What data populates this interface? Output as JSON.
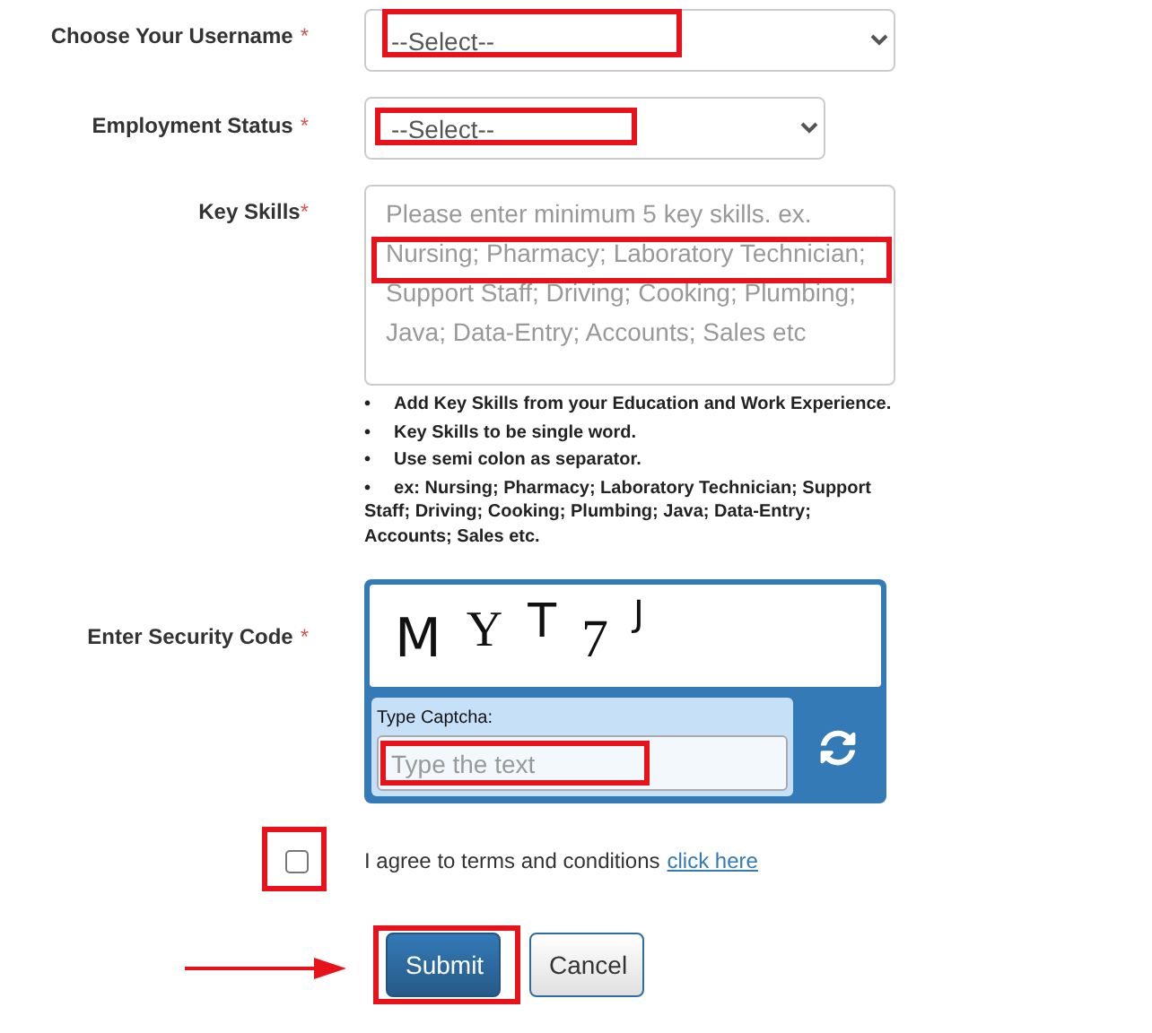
{
  "username": {
    "label": "Choose Your Username",
    "required_mark": "*",
    "value": "--Select--",
    "highlighted": true
  },
  "employment": {
    "label": "Employment Status",
    "required_mark": "*",
    "value": "--Select--",
    "highlighted": true
  },
  "key_skills": {
    "label": "Key Skills",
    "required_mark": "*",
    "placeholder": "Please enter minimum 5 key skills. ex. Nursing; Pharmacy; Laboratory Technician; Support Staff; Driving; Cooking; Plumbing; Java; Data-Entry; Accounts; Sales etc",
    "highlighted": true,
    "hints": [
      {
        "text": "Add Key Skills from your Education and Work Experience.",
        "bullet": "•"
      },
      {
        "text": "Key Skills to be single word.",
        "bullet": "•"
      },
      {
        "text": "Use semi colon as separator.",
        "bullet": "•"
      },
      {
        "text": "ex: Nursing; Pharmacy; Laboratory Technician; Support Staff; Driving; Cooking; Plumbing; Java; Data-Entry; Accounts; Sales etc.",
        "bullet": "•"
      }
    ]
  },
  "security": {
    "label": "Enter Security Code",
    "required_mark": "*",
    "captcha_characters": [
      "M",
      "Y",
      "T",
      "7",
      "J"
    ],
    "input_label": "Type Captcha:",
    "placeholder": "Type the text",
    "highlighted": true
  },
  "terms": {
    "checked": false,
    "highlighted": true,
    "text": "I agree to terms and conditions",
    "link": "click here"
  },
  "buttons": [
    {
      "label": "Submit",
      "kind": "primary",
      "highlighted": true,
      "arrow": true
    },
    {
      "label": "Cancel",
      "kind": "default",
      "highlighted": false,
      "arrow": false
    }
  ]
}
